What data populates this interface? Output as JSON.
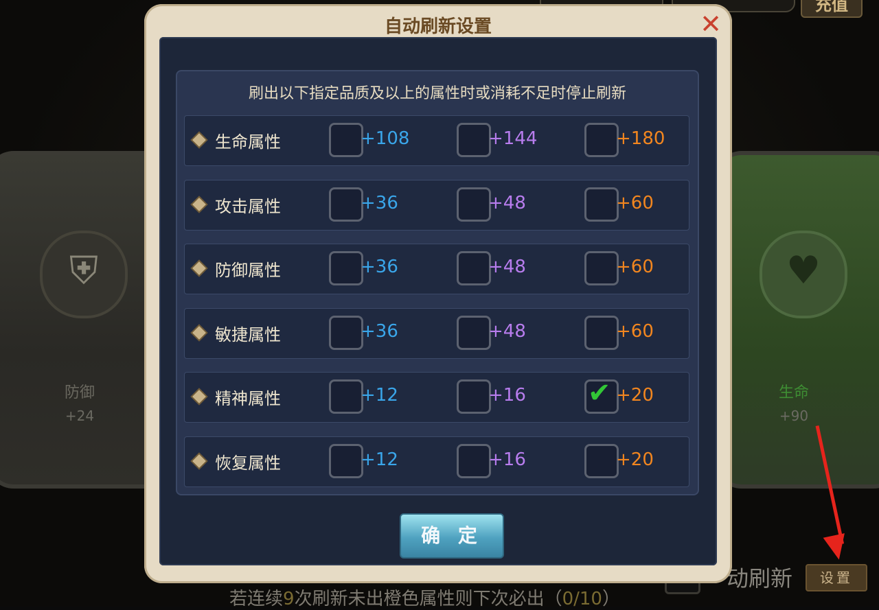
{
  "dialog": {
    "title": "自动刷新设置",
    "close_icon": "close-x-icon",
    "header_text": "刷出以下指定品质及以上的属性时或消耗不足时停止刷新",
    "confirm_label": "确 定",
    "rows": [
      {
        "label": "生命属性",
        "options": [
          {
            "value": "+108",
            "checked": false
          },
          {
            "value": "+144",
            "checked": false
          },
          {
            "value": "+180",
            "checked": false
          }
        ]
      },
      {
        "label": "攻击属性",
        "options": [
          {
            "value": "+36",
            "checked": false
          },
          {
            "value": "+48",
            "checked": false
          },
          {
            "value": "+60",
            "checked": false
          }
        ]
      },
      {
        "label": "防御属性",
        "options": [
          {
            "value": "+36",
            "checked": false
          },
          {
            "value": "+48",
            "checked": false
          },
          {
            "value": "+60",
            "checked": false
          }
        ]
      },
      {
        "label": "敏捷属性",
        "options": [
          {
            "value": "+36",
            "checked": false
          },
          {
            "value": "+48",
            "checked": false
          },
          {
            "value": "+60",
            "checked": false
          }
        ]
      },
      {
        "label": "精神属性",
        "options": [
          {
            "value": "+12",
            "checked": false
          },
          {
            "value": "+16",
            "checked": false
          },
          {
            "value": "+20",
            "checked": true
          }
        ]
      },
      {
        "label": "恢复属性",
        "options": [
          {
            "value": "+12",
            "checked": false
          },
          {
            "value": "+16",
            "checked": false
          },
          {
            "value": "+20",
            "checked": false
          }
        ]
      }
    ],
    "tier_colors": [
      "#3aa6ea",
      "#b87dee",
      "#f2861f"
    ]
  },
  "background": {
    "left_card": {
      "name": "防御",
      "value": "+24",
      "icon": "shield-helmet-icon"
    },
    "right_card": {
      "name": "生命",
      "value": "+90",
      "icon": "heart-icon"
    },
    "auto_refresh_label": "动刷新",
    "settings_button": "设置",
    "hint": {
      "prefix": "若连续",
      "count": "9",
      "middle": "次刷新未出橙色属性则下次必出（",
      "progress": "0/10",
      "suffix": "）"
    },
    "top_button": "充值"
  }
}
